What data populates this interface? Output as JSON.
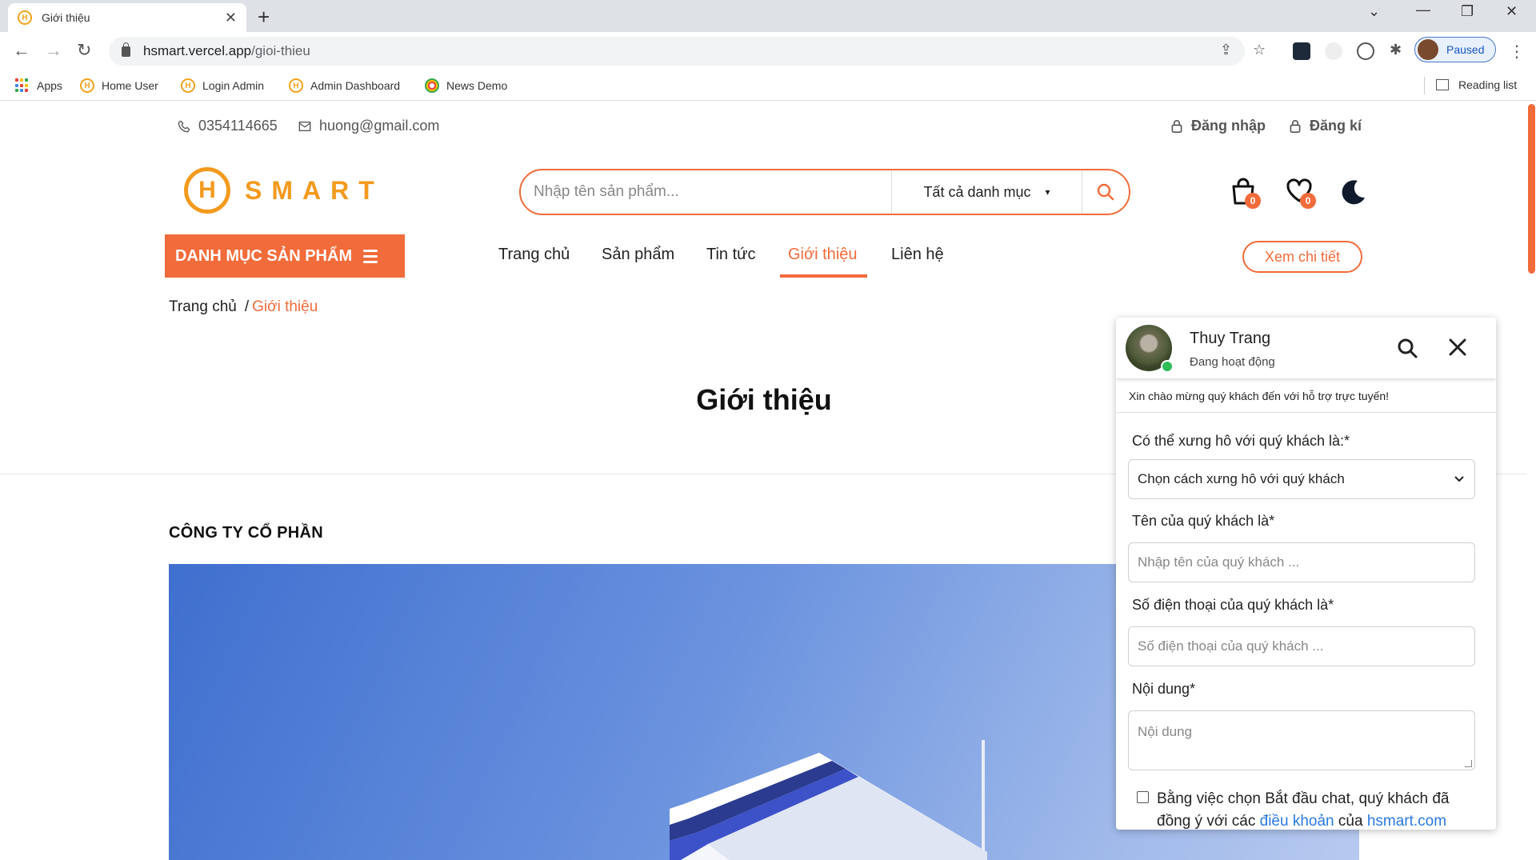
{
  "browser": {
    "tab_title": "Giới thiệu",
    "url_host": "hsmart.vercel.app",
    "url_path": "/gioi-thieu",
    "profile_status": "Paused",
    "bookmarks": [
      "Apps",
      "Home User",
      "Login Admin",
      "Admin Dashboard",
      "News Demo"
    ],
    "reading_list": "Reading list"
  },
  "topbar": {
    "phone": "0354114665",
    "email": "huong@gmail.com",
    "login": "Đăng nhập",
    "register": "Đăng kí"
  },
  "header": {
    "logo_letter": "H",
    "logo_word": "SMART",
    "search_placeholder": "Nhập tên sản phẩm...",
    "category_select": "Tất cả danh mục",
    "cart_count": "0",
    "wishlist_count": "0"
  },
  "nav": {
    "category_button": "DANH MỤC SẢN PHẨM",
    "items": [
      "Trang chủ",
      "Sản phẩm",
      "Tin tức",
      "Giới thiệu",
      "Liên hệ"
    ],
    "active_index": 3,
    "detail_button": "Xem chi tiết"
  },
  "breadcrumb": {
    "home": "Trang chủ",
    "separator": "/",
    "current": "Giới thiệu"
  },
  "main": {
    "title": "Giới thiệu",
    "company_heading": "CÔNG TY CỔ PHẦN"
  },
  "chat": {
    "agent_name": "Thuy Trang",
    "agent_status": "Đang hoạt động",
    "welcome": "Xin chào mừng quý khách đến với hỗ trợ trực tuyến!",
    "salutation_label": "Có thể xưng hô với quý khách là:*",
    "salutation_value": "Chọn cách xưng hô với quý khách",
    "name_label": "Tên của quý khách là*",
    "name_placeholder": "Nhập tên của quý khách ...",
    "phone_label": "Số điện thoại của quý khách là*",
    "phone_placeholder": "Số điện thoại của quý khách ...",
    "content_label": "Nội dung*",
    "content_placeholder": "Nội dung",
    "consent_text": "Bằng việc chọn Bắt đầu chat, quý khách đã đồng ý với các",
    "consent_link": "điều khoản",
    "consent_of": "của",
    "consent_site": "hsmart.com"
  },
  "colors": {
    "accent": "#f26b3a",
    "logo": "#f39a1e",
    "online": "#2ebd59"
  }
}
